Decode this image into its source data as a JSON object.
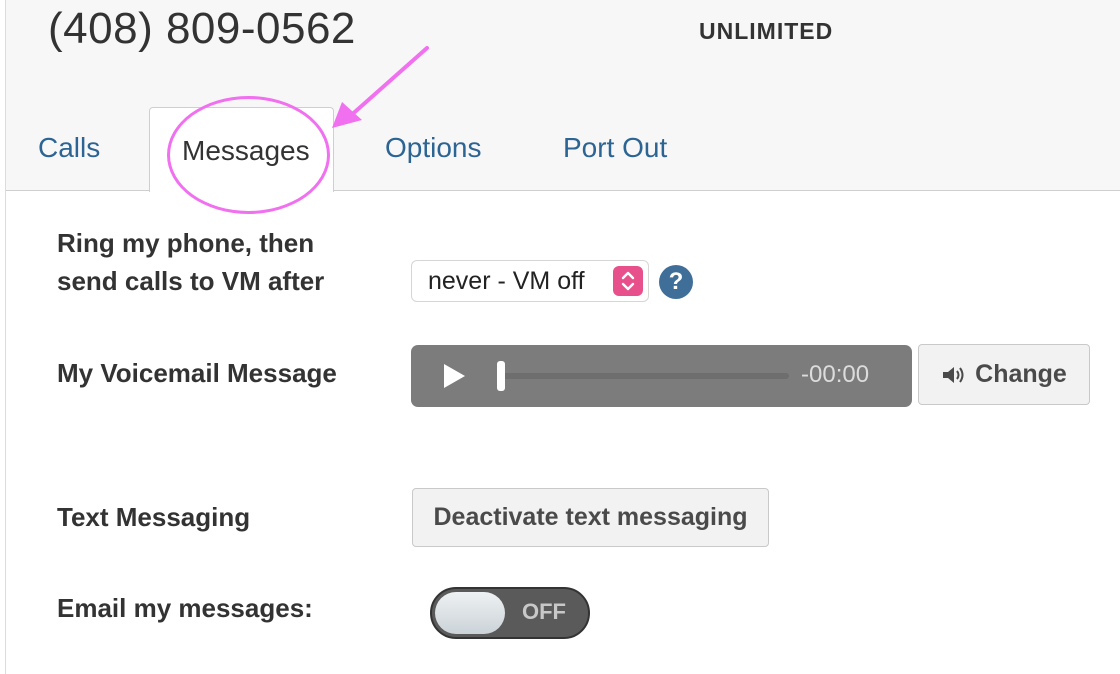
{
  "header": {
    "phone_number": "(408) 809-0562",
    "plan": "UNLIMITED"
  },
  "tabs": [
    {
      "label": "Calls",
      "active": false
    },
    {
      "label": "Messages",
      "active": true
    },
    {
      "label": "Options",
      "active": false
    },
    {
      "label": "Port Out",
      "active": false
    }
  ],
  "voicemail_timeout": {
    "label_line1": "Ring my phone, then",
    "label_line2": "send calls to VM after",
    "selected_value": "never - VM off",
    "help_icon": "?"
  },
  "voicemail_message": {
    "label": "My Voicemail Message",
    "time": "-00:00",
    "change_label": "Change",
    "icons": [
      "play-icon",
      "speaker-icon"
    ]
  },
  "text_messaging": {
    "label": "Text Messaging",
    "button_label": "Deactivate text messaging"
  },
  "email_messages": {
    "label": "Email my messages:",
    "toggle_state": "OFF"
  },
  "colors": {
    "tab_link": "#2c6493",
    "annotation": "#f070f0",
    "select_caret": "#e8508b",
    "help_icon": "#3f6e98",
    "player_bg": "#7c7c7c"
  }
}
